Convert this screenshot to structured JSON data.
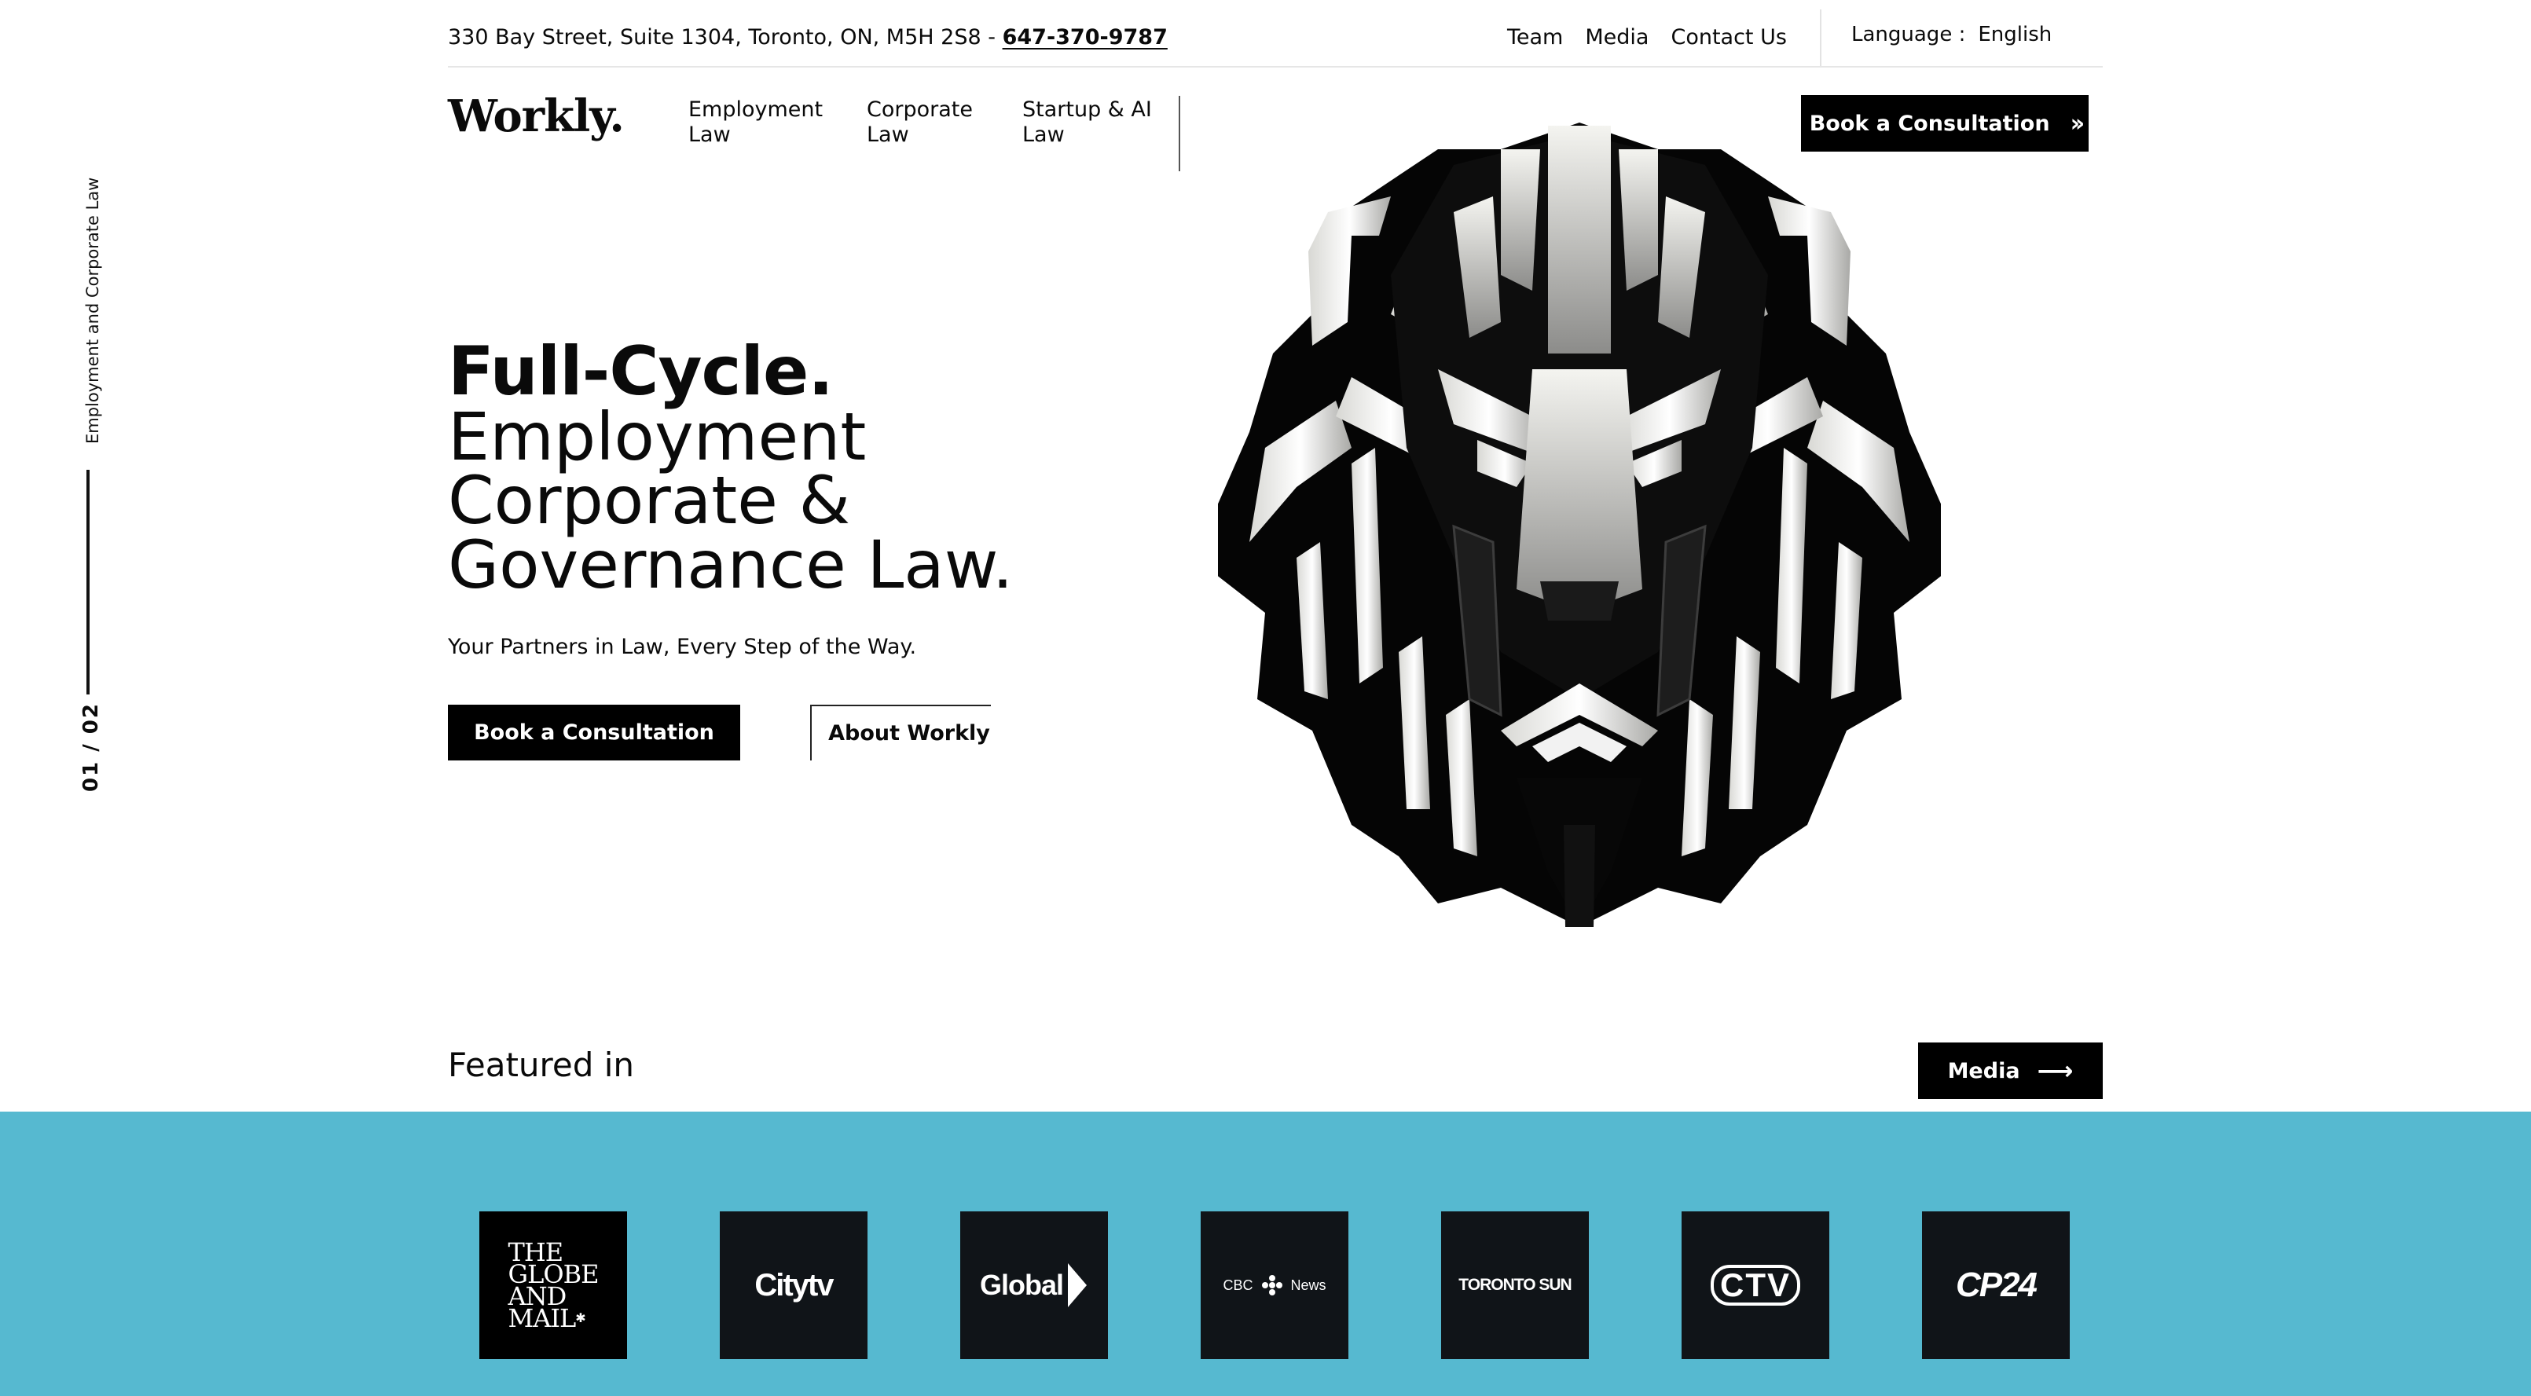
{
  "side_rail": {
    "label": "Employment and Corporate Law",
    "counter": "01 / 02"
  },
  "topbar": {
    "address": "330 Bay Street, Suite 1304, Toronto, ON, M5H 2S8 - ",
    "phone": "647-370-9787",
    "links": [
      "Team",
      "Media",
      "Contact Us"
    ],
    "language_label": "Language :",
    "language_value": "English"
  },
  "nav": {
    "logo": "Workly.",
    "menu": [
      {
        "line1": "Employment",
        "line2": "Law"
      },
      {
        "line1": "Corporate",
        "line2": "Law"
      },
      {
        "line1": "Startup & AI",
        "line2": "Law"
      }
    ],
    "cta": "Book a Consultation",
    "cta_icon": "double-chevron-right-icon"
  },
  "hero": {
    "title_bold": "Full-Cycle.",
    "title_lines": [
      "Employment",
      "Corporate &",
      "Governance Law."
    ],
    "subtitle": "Your Partners in Law, Every Step of the Way.",
    "primary_button": "Book a Consultation",
    "secondary_button": "About Workly",
    "illustration": "geometric-lion-head-illustration"
  },
  "featured": {
    "heading": "Featured in",
    "button": "Media",
    "button_icon": "arrow-right-icon",
    "band_color": "#56b9d0",
    "logos": {
      "globe": [
        "THE",
        "GLOBE",
        "AND",
        "MAIL"
      ],
      "citytv": "Citytv",
      "global": "Global",
      "cbc": "CBC",
      "cbc_news": "News",
      "sun": "TORONTO SUN",
      "ctv": "CTV",
      "cp24": "CP24"
    }
  }
}
